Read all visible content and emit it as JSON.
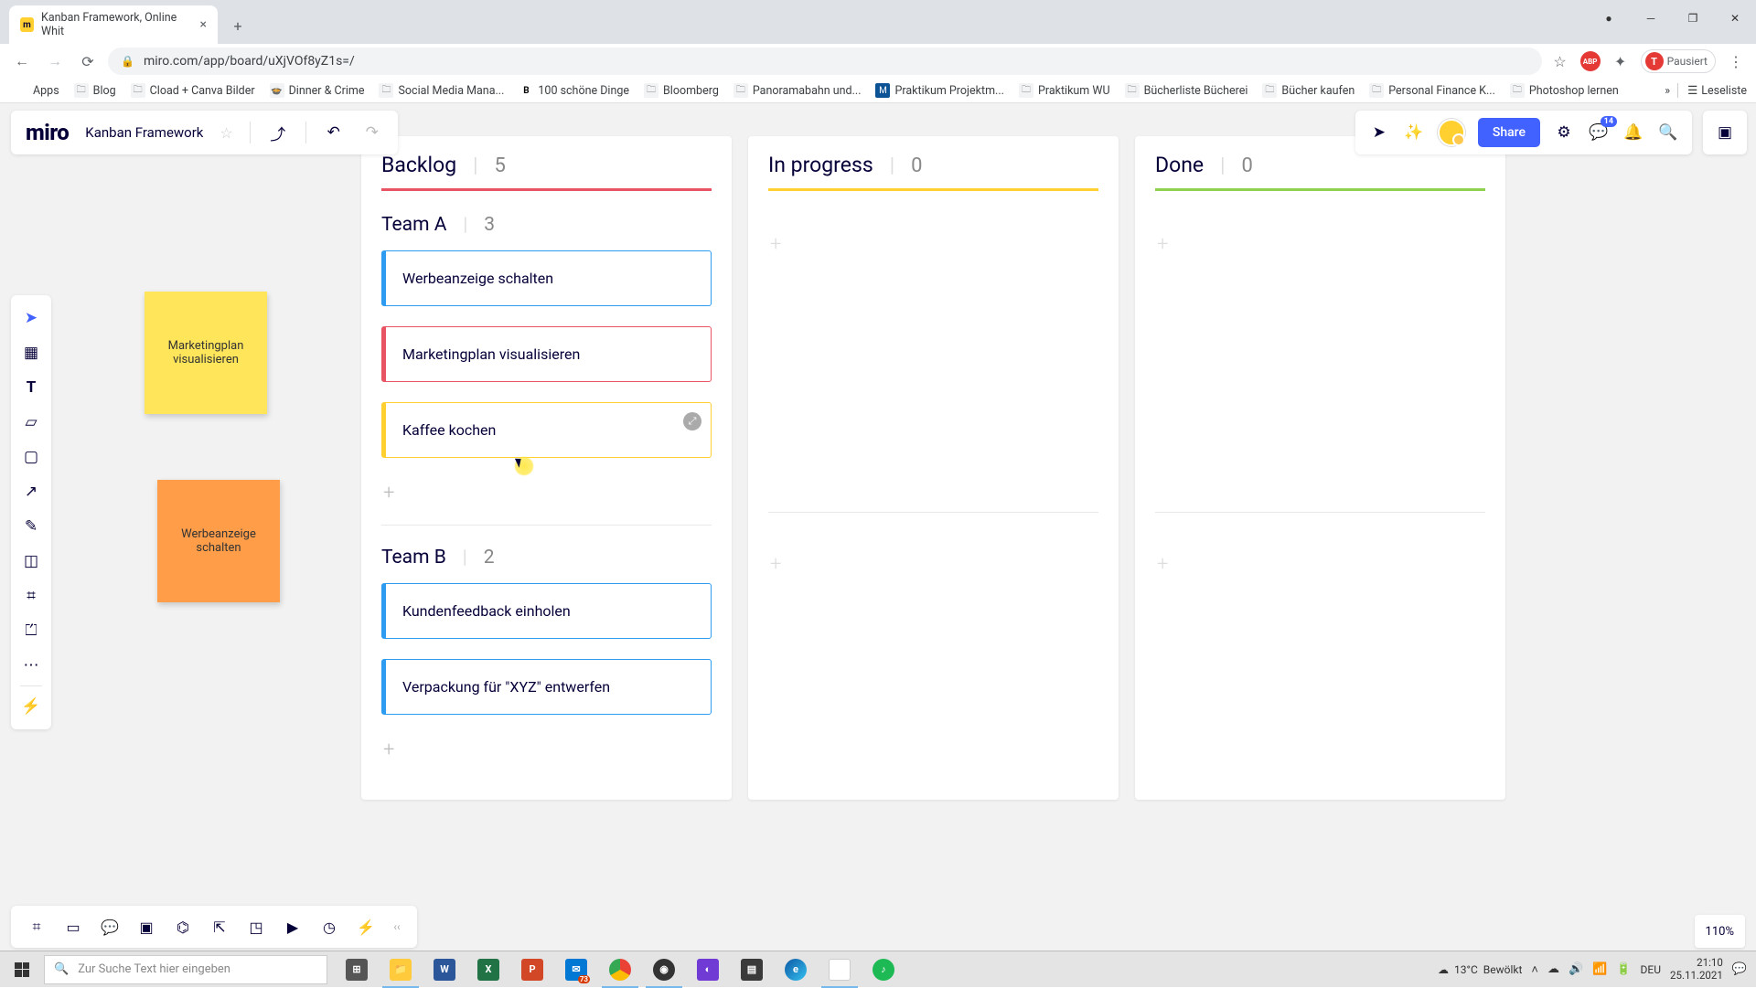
{
  "browser": {
    "tab_title": "Kanban Framework, Online Whit",
    "url": "miro.com/app/board/uXjVOf8yZ1s=/",
    "pause_label": "Pausiert",
    "bookmarks": [
      {
        "label": "Apps",
        "type": "apps"
      },
      {
        "label": "Blog",
        "type": "folder"
      },
      {
        "label": "Cload + Canva Bilder",
        "type": "folder"
      },
      {
        "label": "Dinner & Crime",
        "type": "page"
      },
      {
        "label": "Social Media Mana...",
        "type": "folder"
      },
      {
        "label": "100 schöne Dinge",
        "type": "bold"
      },
      {
        "label": "Bloomberg",
        "type": "folder"
      },
      {
        "label": "Panoramabahn und...",
        "type": "folder"
      },
      {
        "label": "Praktikum Projektm...",
        "type": "page"
      },
      {
        "label": "Praktikum WU",
        "type": "folder"
      },
      {
        "label": "Bücherliste Bücherei",
        "type": "folder"
      },
      {
        "label": "Bücher kaufen",
        "type": "folder"
      },
      {
        "label": "Personal Finance K...",
        "type": "folder"
      },
      {
        "label": "Photoshop lernen",
        "type": "folder"
      }
    ],
    "read_list": "Leseliste"
  },
  "miro": {
    "logo": "miro",
    "board_name": "Kanban Framework",
    "share_label": "Share",
    "comment_count": "14"
  },
  "stickies": {
    "yellow": "Marketingplan visualisieren",
    "orange": "Werbeanzeige schalten"
  },
  "kanban": {
    "columns": [
      {
        "title": "Backlog",
        "count": "5",
        "color": "red"
      },
      {
        "title": "In progress",
        "count": "0",
        "color": "yellow"
      },
      {
        "title": "Done",
        "count": "0",
        "color": "green"
      }
    ],
    "teams": [
      {
        "name": "Team A",
        "count": "3",
        "cards": [
          {
            "text": "Werbeanzeige schalten",
            "color": "blue"
          },
          {
            "text": "Marketingplan visualisieren",
            "color": "red"
          },
          {
            "text": "Kaffee kochen",
            "color": "yellow",
            "hover": true
          }
        ]
      },
      {
        "name": "Team B",
        "count": "2",
        "cards": [
          {
            "text": "Kundenfeedback einholen",
            "color": "blue"
          },
          {
            "text": "Verpackung für \"XYZ\" entwerfen",
            "color": "blue"
          }
        ]
      }
    ]
  },
  "zoom": "110%",
  "taskbar": {
    "search_placeholder": "Zur Suche Text hier eingeben",
    "weather_temp": "13°C",
    "weather_text": "Bewölkt",
    "lang": "DEU",
    "time": "21:10",
    "date": "25.11.2021"
  }
}
